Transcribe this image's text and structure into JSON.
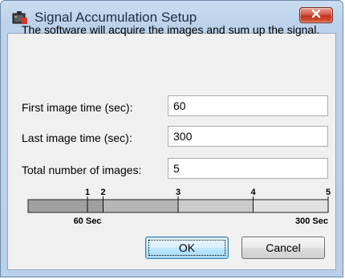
{
  "window": {
    "title": "Signal Accumulation Setup",
    "close_icon": "close-icon",
    "app_icon": "app-icon"
  },
  "description": "The software will acquire the images and sum up the signal.",
  "fields": {
    "first": {
      "label": "First image time (sec):",
      "value": "60"
    },
    "last": {
      "label": "Last image time (sec):",
      "value": "300"
    },
    "total": {
      "label": "Total number of images:",
      "value": "5"
    }
  },
  "scale": {
    "ticks": [
      "1",
      "2",
      "3",
      "4",
      "5"
    ],
    "start_label": "60 Sec",
    "end_label": "300 Sec"
  },
  "buttons": {
    "ok": "OK",
    "cancel": "Cancel"
  },
  "colors": {
    "close_button": "#c8412e",
    "scale_fill": "#a9a9a9"
  }
}
